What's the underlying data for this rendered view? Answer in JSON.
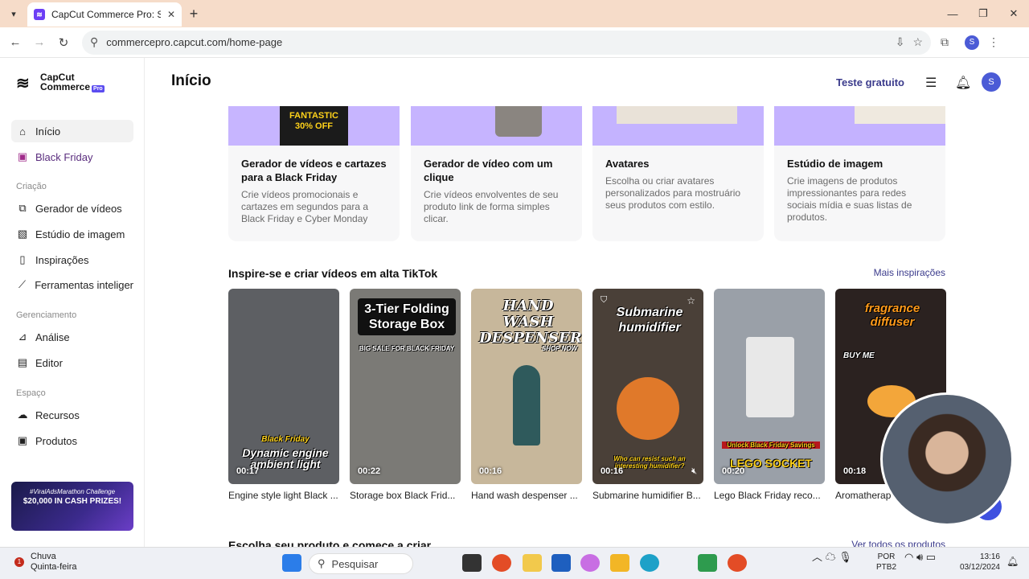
{
  "browser": {
    "tab_title": "CapCut Commerce Pro: Shoppa",
    "url": "commercepro.capcut.com/home-page"
  },
  "sidebar": {
    "logo_line1": "CapCut",
    "logo_line2": "Commerce",
    "logo_badge": "Pro",
    "items": [
      {
        "label": "Início",
        "icon": "home-icon"
      },
      {
        "label": "Black Friday",
        "icon": "shopping-bag-icon"
      }
    ],
    "section_criacao": "Criação",
    "criacao_items": [
      {
        "label": "Gerador de vídeos",
        "icon": "video-generator-icon"
      },
      {
        "label": "Estúdio de imagem",
        "icon": "image-studio-icon"
      },
      {
        "label": "Inspirações",
        "icon": "inspiration-icon"
      },
      {
        "label": "Ferramentas inteligent",
        "icon": "magic-wand-icon"
      }
    ],
    "section_gerenciamento": "Gerenciamento",
    "gerenciamento_items": [
      {
        "label": "Análise",
        "icon": "analytics-icon"
      },
      {
        "label": "Editor",
        "icon": "calendar-icon"
      }
    ],
    "section_espaco": "Espaço",
    "espaco_items": [
      {
        "label": "Recursos",
        "icon": "cloud-icon"
      },
      {
        "label": "Produtos",
        "icon": "product-icon"
      }
    ],
    "promo_line1": "#ViralAdsMarathon Challenge",
    "promo_line2": "$20,000 IN CASH PRIZES!"
  },
  "header": {
    "title": "Início",
    "trial_button": "Teste gratuito"
  },
  "avatar_letter": "S",
  "feature_cards": [
    {
      "title": "Gerador de vídeos e cartazes para a Black Friday",
      "desc": "Crie vídeos promocionais e cartazes em segundos para a Black Friday e Cyber Monday",
      "thumb_text": "FANTASTIC 30% OFF"
    },
    {
      "title": "Gerador de vídeo com um clique",
      "desc": "Crie vídeos envolventes de seu produto link de forma simples clicar.",
      "thumb_text": ""
    },
    {
      "title": "Avatares",
      "desc": "Escolha ou criar avatares personalizados para mostruário seus produtos com estilo.",
      "thumb_text": ""
    },
    {
      "title": "Estúdio de imagem",
      "desc": "Crie imagens de produtos impressionantes para redes sociais mídia e suas listas de produtos.",
      "thumb_text": ""
    }
  ],
  "inspire": {
    "title": "Inspire-se e criar vídeos em alta TikTok",
    "more_link": "Mais inspirações",
    "videos": [
      {
        "caption": "Dynamic engine ambient light",
        "badge": "Black Friday",
        "duration": "00:17",
        "title": "Engine style light Black ...",
        "bg": "#5d5f63"
      },
      {
        "caption": "3-Tier Folding Storage Box",
        "badge": "BIG SALE FOR BLACK FRIDAY",
        "duration": "00:22",
        "title": "Storage box Black Frid...",
        "bg": "#7b7a76"
      },
      {
        "caption": "HAND WASH DESPENSER",
        "badge": "SHOP NOW",
        "duration": "00:16",
        "title": "Hand wash despenser ...",
        "bg": "#c7b79b"
      },
      {
        "caption": "Submarine humidifier",
        "badge": "Who can resist such an interesting humidifier?",
        "duration": "00:16",
        "title": "Submarine humidifier B...",
        "bg": "#4a4038"
      },
      {
        "caption": "LEGO SOCKET",
        "badge": "Unlock Black Friday Savings",
        "duration": "00:20",
        "title": "Lego Black Friday reco...",
        "bg": "#9aa0a8"
      },
      {
        "caption": "fragrance diffuser",
        "badge": "BUY ME",
        "duration": "00:18",
        "title": "Aromatherap",
        "bg": "#2b2220"
      }
    ]
  },
  "products_section": {
    "title": "Escolha seu produto e comece a criar",
    "all_link": "Ver todos os produtos"
  },
  "taskbar": {
    "weather_badge": "1",
    "weather_line1": "Chuva",
    "weather_line2": "Quinta-feira",
    "search_placeholder": "Pesquisar",
    "lang_line1": "POR",
    "lang_line2": "PTB2",
    "time": "13:16",
    "date": "03/12/2024"
  }
}
